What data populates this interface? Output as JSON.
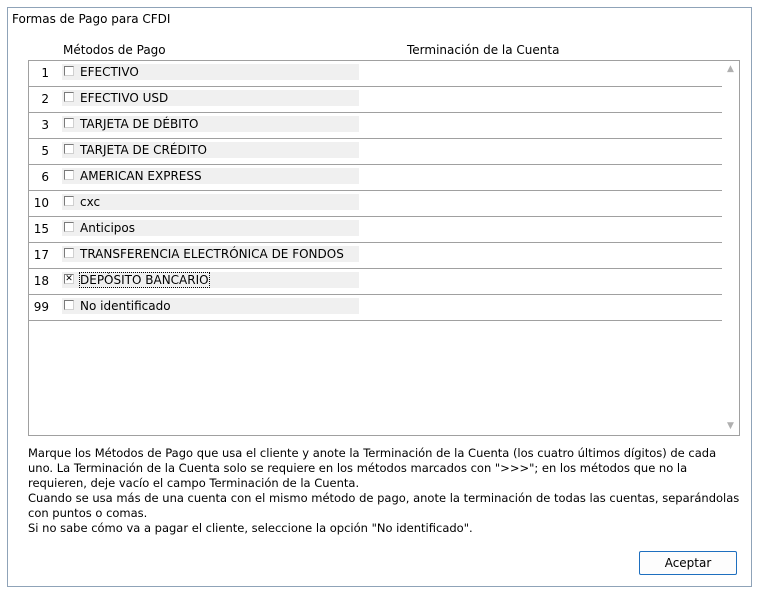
{
  "window": {
    "title": "Formas de Pago para CFDI"
  },
  "columns": {
    "methods": "Métodos de Pago",
    "termination": "Terminación de la Cuenta"
  },
  "rows": [
    {
      "num": "1",
      "label": "EFECTIVO",
      "checked": false
    },
    {
      "num": "2",
      "label": "EFECTIVO USD",
      "checked": false
    },
    {
      "num": "3",
      "label": "TARJETA DE DÉBITO",
      "checked": false
    },
    {
      "num": "5",
      "label": "TARJETA DE CRÉDITO",
      "checked": false
    },
    {
      "num": "6",
      "label": "AMERICAN EXPRESS",
      "checked": false
    },
    {
      "num": "10",
      "label": "cxc",
      "checked": false
    },
    {
      "num": "15",
      "label": "Anticipos",
      "checked": false
    },
    {
      "num": "17",
      "label": "TRANSFERENCIA ELECTRÓNICA DE FONDOS",
      "checked": false
    },
    {
      "num": "18",
      "label": "DEPÓSITO BANCARIO",
      "checked": true,
      "focused": true
    },
    {
      "num": "99",
      "label": "No identificado",
      "checked": false
    }
  ],
  "help": {
    "p1": "Marque los Métodos de Pago que usa el cliente y anote la Terminación de la Cuenta (los cuatro últimos dígitos) de cada uno. La Terminación de la Cuenta solo se requiere en los métodos marcados con \">>>\"; en los métodos que no la requieren, deje vacío el campo Terminación de la Cuenta.",
    "p2": "Cuando se usa más de una cuenta con el mismo método de pago, anote la terminación de todas las cuentas, separándolas con puntos o comas.",
    "p3": "Si no sabe cómo va a pagar el cliente, seleccione la opción \"No identificado\"."
  },
  "buttons": {
    "accept": "Aceptar"
  },
  "icons": {
    "scroll_up": "triangle-up-icon",
    "scroll_down": "triangle-down-icon"
  }
}
